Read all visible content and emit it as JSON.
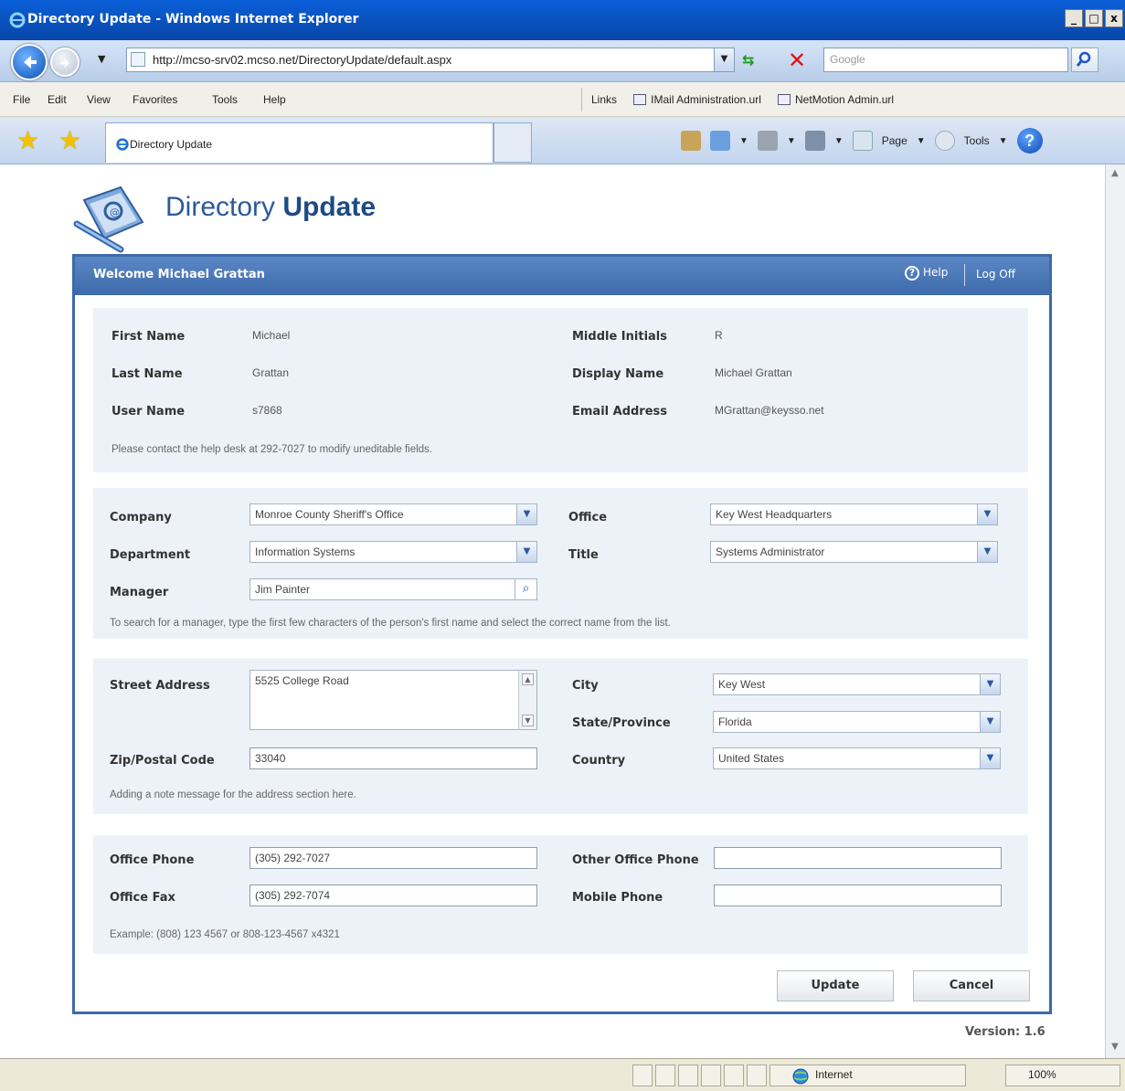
{
  "window": {
    "title": "Directory Update - Windows Internet Explorer"
  },
  "address_bar": {
    "url": "http://mcso-srv02.mcso.net/DirectoryUpdate/default.aspx"
  },
  "search_bar": {
    "placeholder": "Google"
  },
  "menu": {
    "items": [
      "File",
      "Edit",
      "View",
      "Favorites",
      "Tools",
      "Help"
    ],
    "links_label": "Links",
    "links": [
      "IMail Administration.url",
      "NetMotion Admin.url"
    ]
  },
  "tab": {
    "title": "Directory Update"
  },
  "command_bar": {
    "page_label": "Page",
    "tools_label": "Tools"
  },
  "status_bar": {
    "zone": "Internet",
    "zoom": "100%"
  },
  "app": {
    "title_light": "Directory",
    "title_bold": "Update",
    "welcome": "Welcome Michael Grattan",
    "help_label": "Help",
    "logoff_label": "Log Off",
    "version": "Version: 1.6"
  },
  "identity": {
    "first_name_label": "First Name",
    "first_name": "Michael",
    "last_name_label": "Last Name",
    "last_name": "Grattan",
    "user_name_label": "User Name",
    "user_name": "s7868",
    "middle_label": "Middle Initials",
    "middle": "R",
    "display_label": "Display Name",
    "display": "Michael Grattan",
    "email_label": "Email Address",
    "email": "MGrattan@keysso.net",
    "note": "Please contact the help desk at 292-7027 to modify uneditable fields."
  },
  "org": {
    "company_label": "Company",
    "company": "Monroe County Sheriff's Office",
    "department_label": "Department",
    "department": "Information Systems",
    "manager_label": "Manager",
    "manager": "Jim Painter",
    "office_label": "Office",
    "office": "Key West Headquarters",
    "title_label": "Title",
    "title": "Systems Administrator",
    "note": "To search for a manager, type the first few characters of the person's first name and select the correct name from the list."
  },
  "address": {
    "street_label": "Street Address",
    "street": "5525 College Road",
    "zip_label": "Zip/Postal Code",
    "zip": "33040",
    "city_label": "City",
    "city": "Key West",
    "state_label": "State/Province",
    "state": "Florida",
    "country_label": "Country",
    "country": "United States",
    "note": "Adding a note message for the address section here."
  },
  "phones": {
    "office_phone_label": "Office Phone",
    "office_phone": "(305) 292-7027",
    "office_fax_label": "Office Fax",
    "office_fax": "(305) 292-7074",
    "other_phone_label": "Other Office Phone",
    "other_phone": "",
    "mobile_label": "Mobile Phone",
    "mobile": "",
    "note": "Example: (808) 123 4567 or 808-123-4567 x4321"
  },
  "actions": {
    "update": "Update",
    "cancel": "Cancel"
  },
  "colors": {
    "accent": "#3d6aa8",
    "section_bg": "#edf2f8",
    "title": "#2a5a9a"
  }
}
